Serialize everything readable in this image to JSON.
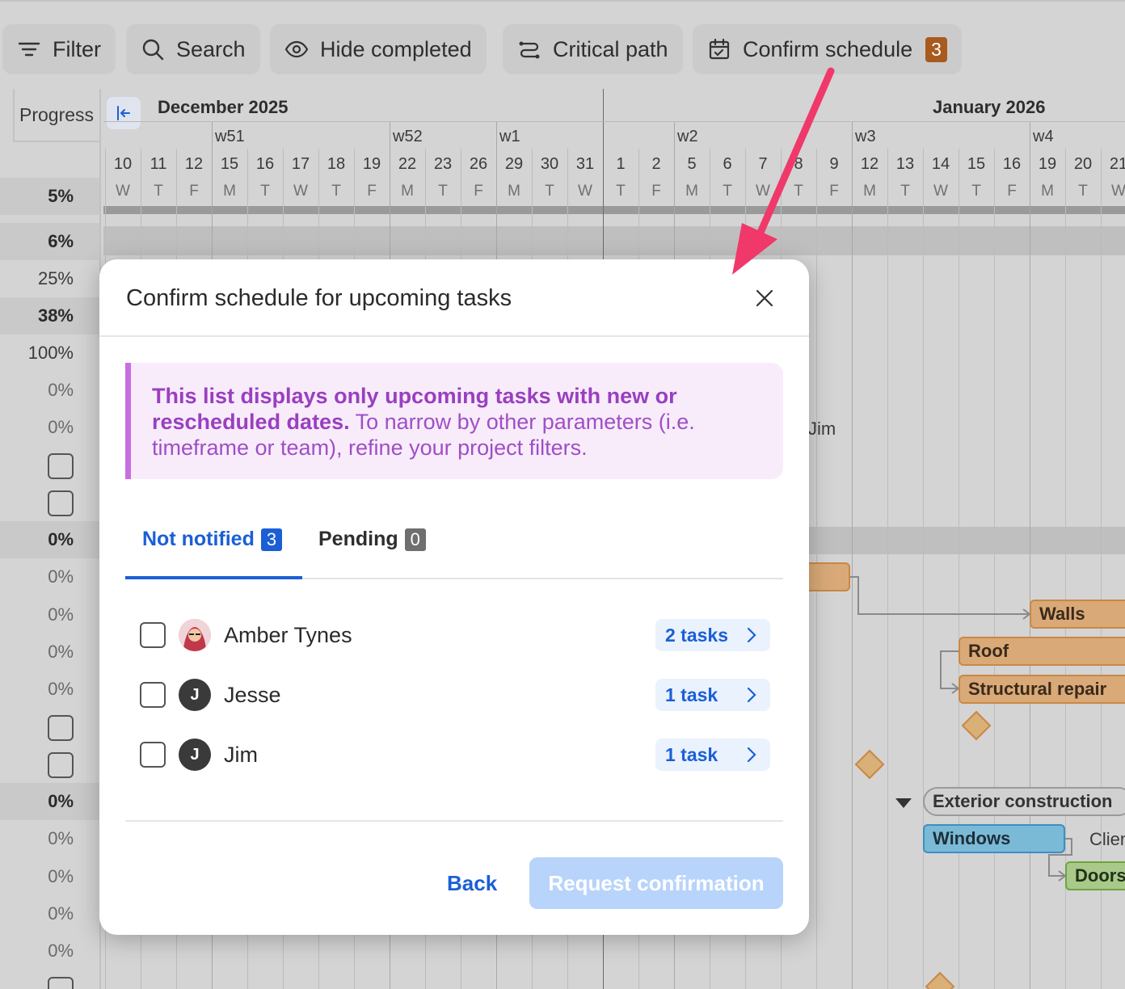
{
  "toolbar": {
    "filter": "Filter",
    "search": "Search",
    "hide_completed": "Hide completed",
    "critical_path": "Critical path",
    "confirm_schedule": "Confirm schedule",
    "confirm_count": "3",
    "badge_color": "#a85a1f"
  },
  "left": {
    "progress_header": "Progress",
    "rows": [
      "5%",
      "6%",
      "25%",
      "38%",
      "100%",
      "0%",
      "0%",
      "0%",
      "0%",
      "0%",
      "0%",
      "0%",
      "0%",
      "0%",
      "0%",
      "0%",
      "0%"
    ]
  },
  "timeline": {
    "month1": "December 2025",
    "month2": "January 2026",
    "weeks": [
      "w51",
      "w52",
      "w1",
      "w2",
      "w3",
      "w4"
    ],
    "days": [
      "10",
      "11",
      "12",
      "15",
      "16",
      "17",
      "18",
      "19",
      "22",
      "23",
      "26",
      "29",
      "30",
      "31",
      "1",
      "2",
      "5",
      "6",
      "7",
      "8",
      "9",
      "12",
      "13",
      "14",
      "15",
      "16",
      "19",
      "20",
      "21"
    ],
    "letters": [
      "W",
      "T",
      "F",
      "M",
      "T",
      "W",
      "T",
      "F",
      "M",
      "T",
      "F",
      "M",
      "T",
      "W",
      "T",
      "F",
      "M",
      "T",
      "W",
      "T",
      "F",
      "M",
      "T",
      "W",
      "T",
      "F",
      "M",
      "T",
      "W"
    ],
    "bars": {
      "walls": "Walls",
      "roof": "Roof",
      "structural": "Structural repair",
      "exterior": "Exterior construction",
      "windows": "Windows",
      "doors": "Doors",
      "jim": "Jim",
      "client": "Clien"
    }
  },
  "modal": {
    "title": "Confirm schedule for upcoming tasks",
    "note_bold": "This list displays only upcoming tasks with new or rescheduled dates.",
    "note_rest": " To narrow by other parameters (i.e. timeframe or team), refine your project filters.",
    "tabs": [
      {
        "label": "Not notified",
        "count": "3"
      },
      {
        "label": "Pending",
        "count": "0"
      }
    ],
    "users": [
      {
        "name": "Amber Tynes",
        "initial": "",
        "tasks": "2 tasks"
      },
      {
        "name": "Jesse",
        "initial": "J",
        "tasks": "1 task"
      },
      {
        "name": "Jim",
        "initial": "J",
        "tasks": "1 task"
      }
    ],
    "back": "Back",
    "request": "Request confirmation",
    "accent": "#1b5fd6",
    "note_accent": "#c86de0"
  }
}
